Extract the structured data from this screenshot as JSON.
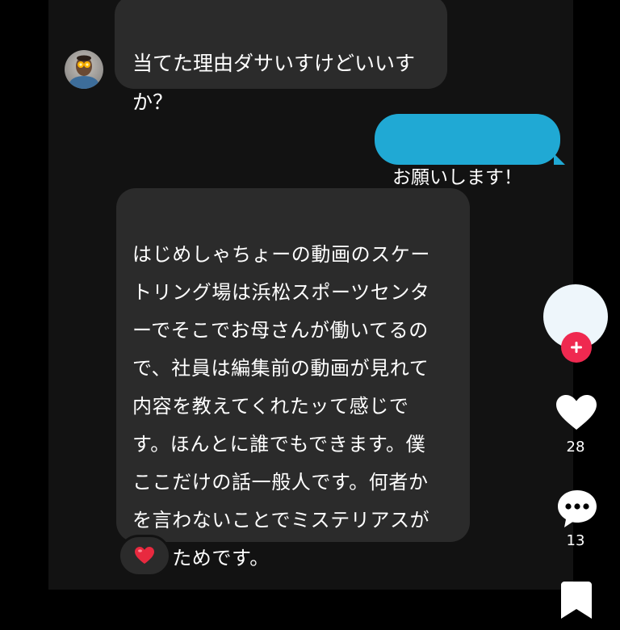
{
  "messages": [
    {
      "direction": "received",
      "text": "当てた理由ダサいすけどいいす\nか？"
    },
    {
      "direction": "sent",
      "text": "お願いします！"
    },
    {
      "direction": "received",
      "text": "はじめしゃちょーの動画のスケー\nトリング場は浜松スポーツセンタ\nーでそこでお母さんが働いてるの\nで、社員は編集前の動画が見れて\n内容を教えてくれたッて感じで\nす。ほんとに誰でもできます。僕\nここだけの話一般人です。何者か\nを言わないことでミステリアスが\nあるためです。",
      "reaction_icon": "heart-emoji"
    }
  ],
  "sidebar": {
    "like_count": "28",
    "comment_count": "13"
  },
  "colors": {
    "background": "#000000",
    "chat_panel": "#121212",
    "received_bubble": "#2b2b2b",
    "sent_bubble": "#20a9d4",
    "follow_button": "#ef2950",
    "reaction_heart": "#e8293f"
  },
  "icons": {
    "avatar": "avatar-icon",
    "follow": "plus-icon",
    "like": "heart-icon",
    "comment": "comment-icon",
    "bookmark": "bookmark-icon"
  }
}
